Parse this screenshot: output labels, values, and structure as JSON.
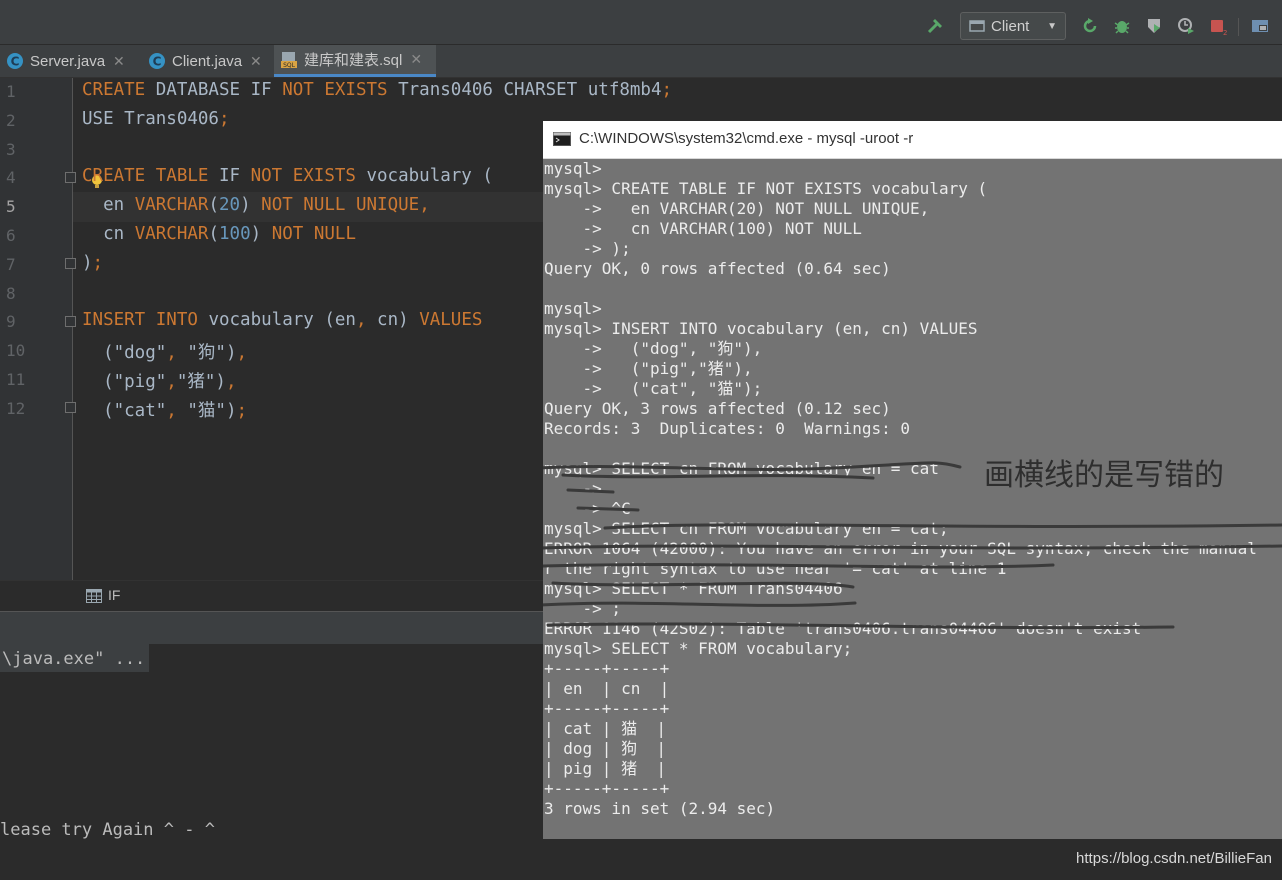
{
  "toolbar": {
    "run_config": "Client",
    "icons": [
      "hammer-icon",
      "rerun-icon",
      "debug-icon",
      "coverage-icon",
      "profile-icon",
      "stop-icon",
      "project-structure-icon"
    ]
  },
  "tabs": [
    {
      "label": "Server.java",
      "icon": "java-class-icon"
    },
    {
      "label": "Client.java",
      "icon": "java-class-icon"
    },
    {
      "label": "建库和建表.sql",
      "icon": "sql-file-icon"
    }
  ],
  "editor": {
    "line_numbers": [
      "1",
      "2",
      "3",
      "4",
      "5",
      "6",
      "7",
      "8",
      "9",
      "10",
      "11",
      "12"
    ],
    "current_line": 5,
    "lines": [
      [
        {
          "t": "CREATE",
          "c": "kw"
        },
        {
          "t": " DATABASE ",
          "c": "plain"
        },
        {
          "t": "IF",
          "c": "plain"
        },
        {
          "t": " ",
          "c": "plain"
        },
        {
          "t": "NOT EXISTS",
          "c": "kw"
        },
        {
          "t": " Trans0406 CHARSET utf8mb4",
          "c": "plain"
        },
        {
          "t": ";",
          "c": "kw"
        }
      ],
      [
        {
          "t": "USE Trans0406",
          "c": "plain"
        },
        {
          "t": ";",
          "c": "kw"
        }
      ],
      [],
      [
        {
          "t": "CREATE TABLE",
          "c": "kw"
        },
        {
          "t": " IF ",
          "c": "plain"
        },
        {
          "t": "NOT EXISTS",
          "c": "kw"
        },
        {
          "t": " vocabulary (",
          "c": "plain"
        }
      ],
      [
        {
          "t": "  en ",
          "c": "plain"
        },
        {
          "t": "VARCHAR",
          "c": "kw"
        },
        {
          "t": "(",
          "c": "plain"
        },
        {
          "t": "20",
          "c": "num"
        },
        {
          "t": ") ",
          "c": "plain"
        },
        {
          "t": "NOT NULL UNIQUE",
          "c": "kw"
        },
        {
          "t": ",",
          "c": "kw"
        }
      ],
      [
        {
          "t": "  cn ",
          "c": "plain"
        },
        {
          "t": "VARCHAR",
          "c": "kw"
        },
        {
          "t": "(",
          "c": "plain"
        },
        {
          "t": "100",
          "c": "num"
        },
        {
          "t": ") ",
          "c": "plain"
        },
        {
          "t": "NOT NULL",
          "c": "kw"
        }
      ],
      [
        {
          "t": ")",
          "c": "plain"
        },
        {
          "t": ";",
          "c": "kw"
        }
      ],
      [],
      [
        {
          "t": "INSERT INTO",
          "c": "kw"
        },
        {
          "t": " vocabulary (en",
          "c": "plain"
        },
        {
          "t": ",",
          "c": "kw"
        },
        {
          "t": " cn) ",
          "c": "plain"
        },
        {
          "t": "VALUES",
          "c": "kw"
        }
      ],
      [
        {
          "t": "  (\"dog\"",
          "c": "plain"
        },
        {
          "t": ",",
          "c": "kw"
        },
        {
          "t": " \"狗\")",
          "c": "plain"
        },
        {
          "t": ",",
          "c": "kw"
        }
      ],
      [
        {
          "t": "  (\"pig\"",
          "c": "plain"
        },
        {
          "t": ",",
          "c": "kw"
        },
        {
          "t": "\"猪\")",
          "c": "plain"
        },
        {
          "t": ",",
          "c": "kw"
        }
      ],
      [
        {
          "t": "  (\"cat\"",
          "c": "plain"
        },
        {
          "t": ",",
          "c": "kw"
        },
        {
          "t": " \"猫\")",
          "c": "plain"
        },
        {
          "t": ";",
          "c": "kw"
        }
      ]
    ]
  },
  "breadcrumb": {
    "label": "IF",
    "icon": "table-icon"
  },
  "console": {
    "command": "\\java.exe\" ...",
    "output": "lease try Again ^ - ^"
  },
  "cmd_window": {
    "title": "C:\\WINDOWS\\system32\\cmd.exe - mysql  -uroot -r",
    "lines": [
      "mysql>",
      "mysql> CREATE TABLE IF NOT EXISTS vocabulary (",
      "    ->   en VARCHAR(20) NOT NULL UNIQUE,",
      "    ->   cn VARCHAR(100) NOT NULL",
      "    -> );",
      "Query OK, 0 rows affected (0.64 sec)",
      "",
      "mysql>",
      "mysql> INSERT INTO vocabulary (en, cn) VALUES",
      "    ->   (\"dog\", \"狗\"),",
      "    ->   (\"pig\",\"猪\"),",
      "    ->   (\"cat\", \"猫\");",
      "Query OK, 3 rows affected (0.12 sec)",
      "Records: 3  Duplicates: 0  Warnings: 0",
      "",
      "mysql> SELECT cn FROM vocabulary en = cat",
      "    ->",
      "    -> ^C",
      "mysql> SELECT cn FROM vocabulary en = cat;",
      "ERROR 1064 (42000): You have an error in your SQL syntax; check the manual",
      "r the right syntax to use near '= cat' at line 1",
      "mysql> SELECT * FROM Trans04406",
      "    -> ;",
      "ERROR 1146 (42S02): Table 'trans0406.trans04406' doesn't exist",
      "mysql> SELECT * FROM vocabulary;",
      "+-----+-----+",
      "| en  | cn  |",
      "+-----+-----+",
      "| cat | 猫  |",
      "| dog | 狗  |",
      "| pig | 猪  |",
      "+-----+-----+",
      "3 rows in set (2.94 sec)"
    ],
    "annotation": "画横线的是写错的"
  },
  "watermark": "https://blog.csdn.net/BillieFan",
  "colors": {
    "keyword": "#cc7832",
    "number": "#6897bb",
    "text": "#a9b7c6",
    "cmd_background": "#737373"
  }
}
